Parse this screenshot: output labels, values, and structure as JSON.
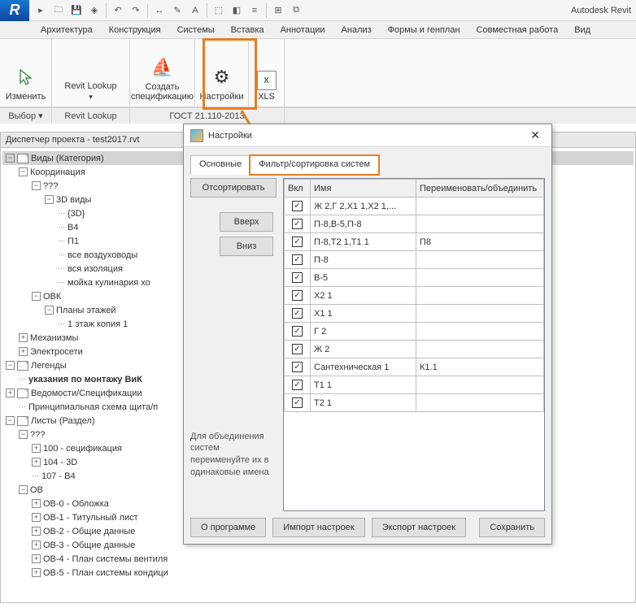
{
  "app_title": "Autodesk Revit",
  "ribbon_tabs": [
    "Архитектура",
    "Конструкция",
    "Системы",
    "Вставка",
    "Аннотации",
    "Анализ",
    "Формы и генплан",
    "Совместная работа",
    "Вид"
  ],
  "panel": {
    "modify": "Изменить",
    "revit_lookup": "Revit Lookup",
    "create_spec": "Создать спецификацию",
    "settings": "Настройки",
    "xls": "XLS"
  },
  "panel_labels": [
    "Выбор ▾",
    "Revit Lookup",
    "ГОСТ 21.110-2013"
  ],
  "browser_title": "Диспетчер проекта - test2017.rvt",
  "tree": [
    {
      "d": 0,
      "exp": "-",
      "t": "Виды (Категория)",
      "sel": true,
      "ic": 0
    },
    {
      "d": 1,
      "exp": "-",
      "t": "Координация"
    },
    {
      "d": 2,
      "exp": "-",
      "t": "???"
    },
    {
      "d": 3,
      "exp": "-",
      "t": "3D виды"
    },
    {
      "d": 4,
      "t": "{3D}"
    },
    {
      "d": 4,
      "t": "В4"
    },
    {
      "d": 4,
      "t": "П1"
    },
    {
      "d": 4,
      "t": "все воздуховоды"
    },
    {
      "d": 4,
      "t": "вся изоляция"
    },
    {
      "d": 4,
      "t": "мойка кулинария хо"
    },
    {
      "d": 2,
      "exp": "-",
      "t": "ОВК"
    },
    {
      "d": 3,
      "exp": "-",
      "t": "Планы этажей"
    },
    {
      "d": 4,
      "t": "1 этаж копия 1"
    },
    {
      "d": 1,
      "exp": "+",
      "t": "Механизмы"
    },
    {
      "d": 1,
      "exp": "+",
      "t": "Электросети"
    },
    {
      "d": 0,
      "exp": "-",
      "t": "Легенды",
      "ic": 1
    },
    {
      "d": 1,
      "t": "указания по монтажу ВиК",
      "bold": true
    },
    {
      "d": 0,
      "exp": "+",
      "t": "Ведомости/Спецификации",
      "ic": 1
    },
    {
      "d": 1,
      "t": "Принципиальная схема щита/п"
    },
    {
      "d": 0,
      "exp": "-",
      "t": "Листы (Раздел)",
      "ic": 1
    },
    {
      "d": 1,
      "exp": "-",
      "t": "???"
    },
    {
      "d": 2,
      "exp": "+",
      "t": "100 - сецификация"
    },
    {
      "d": 2,
      "exp": "+",
      "t": "104 - 3D"
    },
    {
      "d": 2,
      "t": "107 - В4"
    },
    {
      "d": 1,
      "exp": "-",
      "t": "ОВ"
    },
    {
      "d": 2,
      "exp": "+",
      "t": "ОВ-0 - Обложка"
    },
    {
      "d": 2,
      "exp": "+",
      "t": "ОВ-1 - Титульный лист"
    },
    {
      "d": 2,
      "exp": "+",
      "t": "ОВ-2 - Общие данные"
    },
    {
      "d": 2,
      "exp": "+",
      "t": "ОВ-3 - Общие данные"
    },
    {
      "d": 2,
      "exp": "+",
      "t": "ОВ-4 - План системы вентиля"
    },
    {
      "d": 2,
      "exp": "+",
      "t": "ОВ-5 - План системы кондици"
    }
  ],
  "dialog": {
    "title": "Настройки",
    "tabs": [
      "Основные",
      "Фильтр/сортировка систем"
    ],
    "buttons": {
      "sort": "Отсортировать",
      "up": "Вверх",
      "down": "Вниз"
    },
    "hint": "Для объединения систем переименуйте их в одинаковые имена",
    "columns": [
      "Вкл",
      "Имя",
      "Переименовать/объединить"
    ],
    "rows": [
      {
        "on": true,
        "name": "Ж 2,Г 2,Х1 1,Х2 1,...",
        "rename": ""
      },
      {
        "on": true,
        "name": "П-8,В-5,П-8",
        "rename": ""
      },
      {
        "on": true,
        "name": "П-8,Т2 1,Т1 1",
        "rename": "П8"
      },
      {
        "on": true,
        "name": "П-8",
        "rename": ""
      },
      {
        "on": true,
        "name": "В-5",
        "rename": ""
      },
      {
        "on": true,
        "name": "Х2 1",
        "rename": ""
      },
      {
        "on": true,
        "name": "Х1 1",
        "rename": ""
      },
      {
        "on": true,
        "name": "Г 2",
        "rename": ""
      },
      {
        "on": true,
        "name": "Ж 2",
        "rename": ""
      },
      {
        "on": true,
        "name": "Сантехническая 1",
        "rename": "К1.1"
      },
      {
        "on": true,
        "name": "Т1 1",
        "rename": ""
      },
      {
        "on": true,
        "name": "Т2 1",
        "rename": ""
      }
    ],
    "footer": {
      "about": "О программе",
      "import": "Импорт настроек",
      "export": "Экспорт настроек",
      "save": "Сохранить"
    }
  }
}
